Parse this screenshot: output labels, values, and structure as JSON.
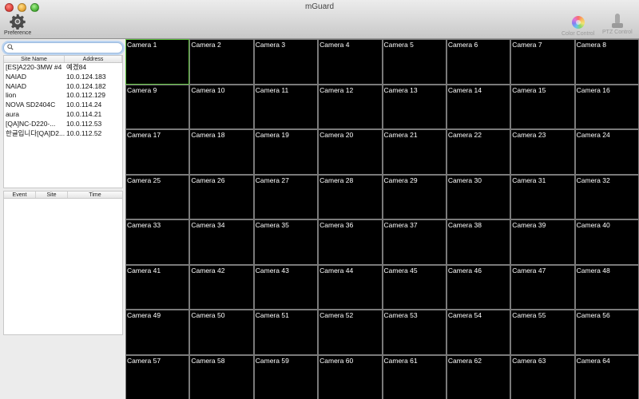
{
  "window": {
    "title": "mGuard"
  },
  "toolbar": {
    "preference_label": "Preference",
    "color_control_label": "Color Control",
    "ptz_control_label": "PTZ Control"
  },
  "search": {
    "value": "",
    "placeholder": ""
  },
  "sites_table": {
    "headers": [
      "Site Name",
      "Address"
    ],
    "rows": [
      {
        "name": "[ES]A220-3MW #4",
        "address": "예겠84"
      },
      {
        "name": "NAIAD",
        "address": "10.0.124.183"
      },
      {
        "name": "NAIAD",
        "address": "10.0.124.182"
      },
      {
        "name": "lion",
        "address": "10.0.112.129"
      },
      {
        "name": "NOVA SD2404C",
        "address": "10.0.114.24"
      },
      {
        "name": "aura",
        "address": "10.0.114.21"
      },
      {
        "name": "[QA]NC-D220-...",
        "address": "10.0.112.53"
      },
      {
        "name": "한글입니다[QA]D2...",
        "address": "10.0.112.52"
      }
    ]
  },
  "events_table": {
    "headers": [
      "Event",
      "Site",
      "Time"
    ],
    "rows": []
  },
  "camera_grid": {
    "selected_index": 0,
    "selected_color": "#5fbf3f",
    "cameras": [
      "Camera 1",
      "Camera 2",
      "Camera 3",
      "Camera 4",
      "Camera 5",
      "Camera 6",
      "Camera 7",
      "Camera 8",
      "Camera 9",
      "Camera 10",
      "Camera 11",
      "Camera 12",
      "Camera 13",
      "Camera 14",
      "Camera 15",
      "Camera 16",
      "Camera 17",
      "Camera 18",
      "Camera 19",
      "Camera 20",
      "Camera 21",
      "Camera 22",
      "Camera 23",
      "Camera 24",
      "Camera 25",
      "Camera 26",
      "Camera 27",
      "Camera 28",
      "Camera 29",
      "Camera 30",
      "Camera 31",
      "Camera 32",
      "Camera 33",
      "Camera 34",
      "Camera 35",
      "Camera 36",
      "Camera 37",
      "Camera 38",
      "Camera 39",
      "Camera 40",
      "Camera 41",
      "Camera 42",
      "Camera 43",
      "Camera 44",
      "Camera 45",
      "Camera 46",
      "Camera 47",
      "Camera 48",
      "Camera 49",
      "Camera 50",
      "Camera 51",
      "Camera 52",
      "Camera 53",
      "Camera 54",
      "Camera 55",
      "Camera 56",
      "Camera 57",
      "Camera 58",
      "Camera 59",
      "Camera 60",
      "Camera 61",
      "Camera 62",
      "Camera 63",
      "Camera 64"
    ]
  }
}
